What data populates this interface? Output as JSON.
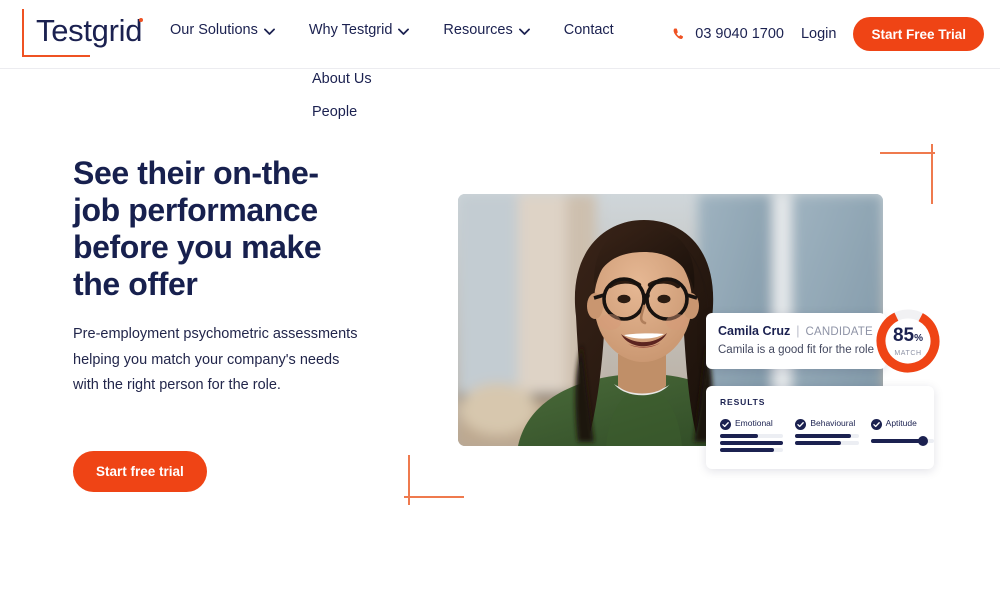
{
  "brand": {
    "logo_text": "Testgrid",
    "accent_orange": "#ef4415",
    "decor_orange": "#ef7a4e",
    "navy": "#1b2150"
  },
  "header": {
    "nav": [
      {
        "label": "Our Solutions",
        "has_caret": true
      },
      {
        "label": "Why Testgrid",
        "has_caret": true
      },
      {
        "label": "Resources",
        "has_caret": true
      },
      {
        "label": "Contact",
        "has_caret": false
      }
    ],
    "phone": "03 9040 1700",
    "login_label": "Login",
    "cta_label": "Start Free Trial"
  },
  "dropdown": {
    "items": [
      {
        "label": "About Us"
      },
      {
        "label": "People"
      }
    ]
  },
  "hero": {
    "title": "See their on-the-job performance before you make the offer",
    "subtitle": "Pre-employment psychometric assessments helping you match your company's needs with the right person for the role.",
    "cta_label": "Start free trial"
  },
  "candidate_card": {
    "name": "Camila Cruz",
    "separator": "|",
    "role": "CANDIDATE",
    "description": "Camila is a good fit for the role"
  },
  "match": {
    "value": "85",
    "percent_symbol": "%",
    "label": "MATCH",
    "ring_fill_ratio": 0.85
  },
  "results": {
    "title": "RESULTS",
    "columns": [
      {
        "label": "Emotional",
        "type": "bars",
        "bars": [
          60,
          100,
          85
        ]
      },
      {
        "label": "Behavioural",
        "type": "bars",
        "bars": [
          88,
          72
        ]
      },
      {
        "label": "Aptitude",
        "type": "slider",
        "slider_value": 82
      }
    ]
  }
}
